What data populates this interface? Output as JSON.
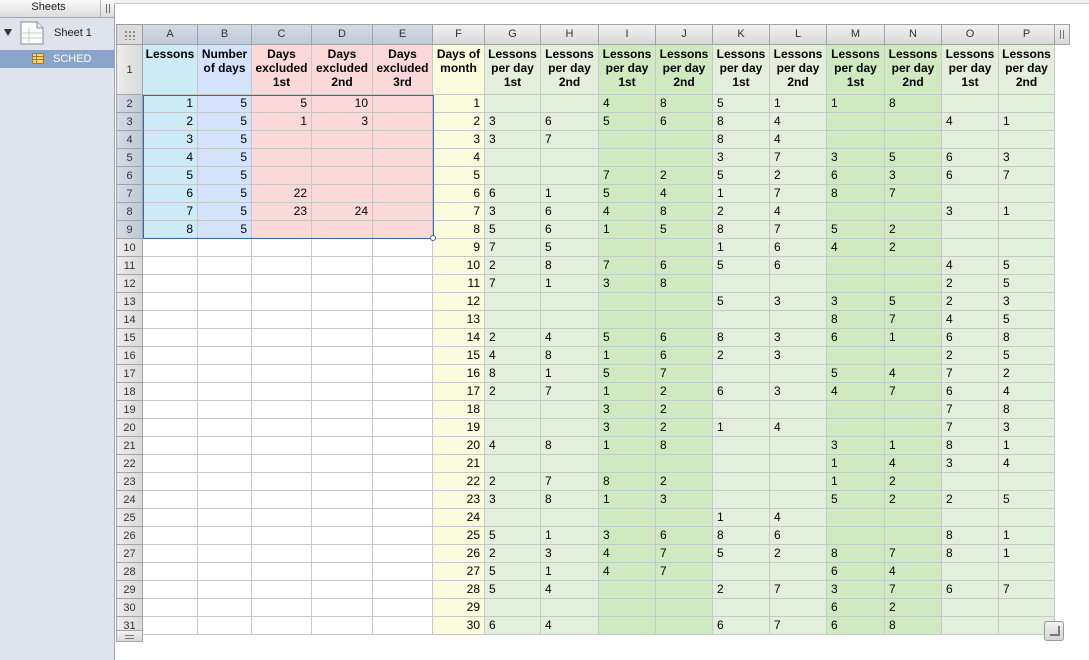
{
  "sidebar": {
    "title": "Sheets",
    "sheet_name": "Sheet 1",
    "table_name": "SCHED"
  },
  "columns": [
    "A",
    "B",
    "C",
    "D",
    "E",
    "F",
    "G",
    "H",
    "I",
    "J",
    "K",
    "L",
    "M",
    "N",
    "O",
    "P"
  ],
  "header_row": [
    "Lessons",
    "Number of days",
    "Days excluded 1st",
    "Days excluded 2nd",
    "Days excluded 3rd",
    "Days of month",
    "Lessons per day 1st",
    "Lessons per day 2nd",
    "Lessons per day 1st",
    "Lessons per day 2nd",
    "Lessons per day 1st",
    "Lessons per day 2nd",
    "Lessons per day 1st",
    "Lessons per day 2nd",
    "Lessons per day 1st",
    "Lessons per day 2nd"
  ],
  "rows": [
    [
      "1",
      "5",
      "5",
      "10",
      "",
      "1",
      "",
      "",
      "4",
      "8",
      "5",
      "1",
      "1",
      "8",
      "",
      ""
    ],
    [
      "2",
      "5",
      "1",
      "3",
      "",
      "2",
      "3",
      "6",
      "5",
      "6",
      "8",
      "4",
      "",
      "",
      "4",
      "1"
    ],
    [
      "3",
      "5",
      "",
      "",
      "",
      "3",
      "3",
      "7",
      "",
      "",
      "8",
      "4",
      "",
      "",
      "",
      ""
    ],
    [
      "4",
      "5",
      "",
      "",
      "",
      "4",
      "",
      "",
      "",
      "",
      "3",
      "7",
      "3",
      "5",
      "6",
      "3"
    ],
    [
      "5",
      "5",
      "",
      "",
      "",
      "5",
      "",
      "",
      "7",
      "2",
      "5",
      "2",
      "6",
      "3",
      "6",
      "7"
    ],
    [
      "6",
      "5",
      "22",
      "",
      "",
      "6",
      "6",
      "1",
      "5",
      "4",
      "1",
      "7",
      "8",
      "7",
      "",
      ""
    ],
    [
      "7",
      "5",
      "23",
      "24",
      "",
      "7",
      "3",
      "6",
      "4",
      "8",
      "2",
      "4",
      "",
      "",
      "3",
      "1"
    ],
    [
      "8",
      "5",
      "",
      "",
      "",
      "8",
      "5",
      "6",
      "1",
      "5",
      "8",
      "7",
      "5",
      "2",
      "",
      ""
    ],
    [
      "",
      "",
      "",
      "",
      "",
      "9",
      "7",
      "5",
      "",
      "",
      "1",
      "6",
      "4",
      "2",
      "",
      ""
    ],
    [
      "",
      "",
      "",
      "",
      "",
      "10",
      "2",
      "8",
      "7",
      "6",
      "5",
      "6",
      "",
      "",
      "4",
      "5"
    ],
    [
      "",
      "",
      "",
      "",
      "",
      "11",
      "7",
      "1",
      "3",
      "8",
      "",
      "",
      "",
      "",
      "2",
      "5"
    ],
    [
      "",
      "",
      "",
      "",
      "",
      "12",
      "",
      "",
      "",
      "",
      "5",
      "3",
      "3",
      "5",
      "2",
      "3"
    ],
    [
      "",
      "",
      "",
      "",
      "",
      "13",
      "",
      "",
      "",
      "",
      "",
      "",
      "8",
      "7",
      "4",
      "5"
    ],
    [
      "",
      "",
      "",
      "",
      "",
      "14",
      "2",
      "4",
      "5",
      "6",
      "8",
      "3",
      "6",
      "1",
      "6",
      "8"
    ],
    [
      "",
      "",
      "",
      "",
      "",
      "15",
      "4",
      "8",
      "1",
      "6",
      "2",
      "3",
      "",
      "",
      "2",
      "5"
    ],
    [
      "",
      "",
      "",
      "",
      "",
      "16",
      "8",
      "1",
      "5",
      "7",
      "",
      "",
      "5",
      "4",
      "7",
      "2"
    ],
    [
      "",
      "",
      "",
      "",
      "",
      "17",
      "2",
      "7",
      "1",
      "2",
      "6",
      "3",
      "4",
      "7",
      "6",
      "4"
    ],
    [
      "",
      "",
      "",
      "",
      "",
      "18",
      "",
      "",
      "3",
      "2",
      "",
      "",
      "",
      "",
      "7",
      "8"
    ],
    [
      "",
      "",
      "",
      "",
      "",
      "19",
      "",
      "",
      "3",
      "2",
      "1",
      "4",
      "",
      "",
      "7",
      "3"
    ],
    [
      "",
      "",
      "",
      "",
      "",
      "20",
      "4",
      "8",
      "1",
      "8",
      "",
      "",
      "3",
      "1",
      "8",
      "1"
    ],
    [
      "",
      "",
      "",
      "",
      "",
      "21",
      "",
      "",
      "",
      "",
      "",
      "",
      "1",
      "4",
      "3",
      "4"
    ],
    [
      "",
      "",
      "",
      "",
      "",
      "22",
      "2",
      "7",
      "8",
      "2",
      "",
      "",
      "1",
      "2",
      "",
      ""
    ],
    [
      "",
      "",
      "",
      "",
      "",
      "23",
      "3",
      "8",
      "1",
      "3",
      "",
      "",
      "5",
      "2",
      "2",
      "5"
    ],
    [
      "",
      "",
      "",
      "",
      "",
      "24",
      "",
      "",
      "",
      "",
      "1",
      "4",
      "",
      "",
      "",
      ""
    ],
    [
      "",
      "",
      "",
      "",
      "",
      "25",
      "5",
      "1",
      "3",
      "6",
      "8",
      "6",
      "",
      "",
      "8",
      "1"
    ],
    [
      "",
      "",
      "",
      "",
      "",
      "26",
      "2",
      "3",
      "4",
      "7",
      "5",
      "2",
      "8",
      "7",
      "8",
      "1"
    ],
    [
      "",
      "",
      "",
      "",
      "",
      "27",
      "5",
      "1",
      "4",
      "7",
      "",
      "",
      "6",
      "4",
      "",
      ""
    ],
    [
      "",
      "",
      "",
      "",
      "",
      "28",
      "5",
      "4",
      "",
      "",
      "2",
      "7",
      "3",
      "7",
      "6",
      "7"
    ],
    [
      "",
      "",
      "",
      "",
      "",
      "29",
      "",
      "",
      "",
      "",
      "",
      "",
      "6",
      "2",
      "",
      ""
    ],
    [
      "",
      "",
      "",
      "",
      "",
      "30",
      "6",
      "4",
      "",
      "",
      "6",
      "7",
      "6",
      "8",
      "",
      ""
    ]
  ],
  "colors": {
    "lessons_blue": "#cdeaf7",
    "days_blue": "#d4e2fb",
    "excluded_pink": "#fbd9d9",
    "month_yellow": "#fbfbdd",
    "lesson_green_light": "#e2efda",
    "lesson_green_dark": "#cfe9c1",
    "selection": "#3a63b8"
  }
}
